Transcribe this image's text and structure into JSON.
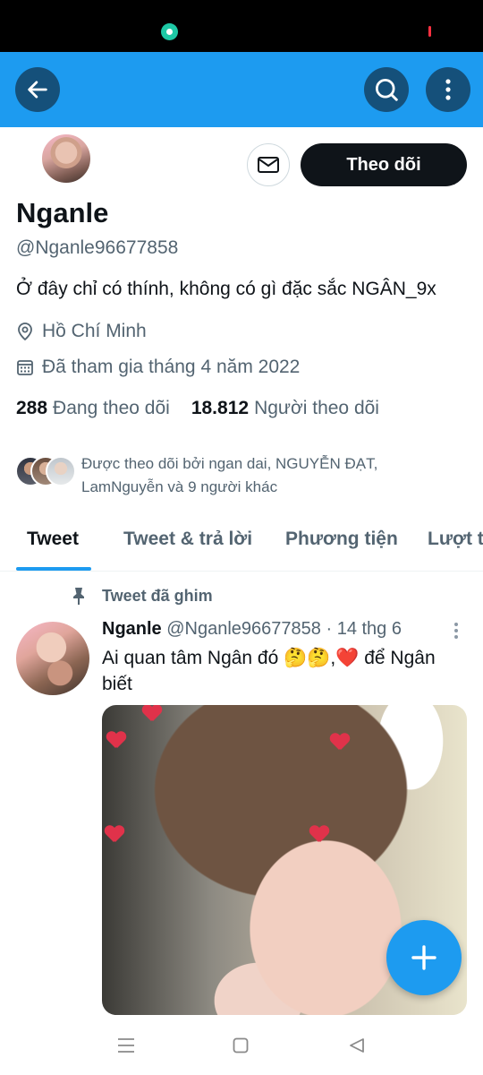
{
  "header": {
    "back_icon": "arrow-left-icon",
    "search_icon": "search-icon",
    "more_icon": "more-vertical-icon",
    "color": "#1d9bf0"
  },
  "profile": {
    "display_name": "Nganle",
    "handle": "@Nganle96677858",
    "bio": "Ở đây chỉ có thính, không có gì đặc sắc  NGÂN_9x",
    "location": "Hồ Chí Minh",
    "joined": "Đã tham gia tháng 4 năm 2022",
    "following_count": "288",
    "following_label": "Đang theo dõi",
    "followers_count": "18.812",
    "followers_label": "Người theo dõi",
    "follow_button": "Theo dõi",
    "followed_by_text": "Được theo dõi bởi ngan dai, NGUYỄN ĐẠT, LamNguyễn và 9 người khác"
  },
  "tabs": [
    {
      "label": "Tweet",
      "active": true
    },
    {
      "label": "Tweet & trả lời",
      "active": false
    },
    {
      "label": "Phương tiện",
      "active": false
    },
    {
      "label": "Lượt thích",
      "active": false
    }
  ],
  "pinned_tweet": {
    "pinned_label": "Tweet đã ghim",
    "author_name": "Nganle",
    "author_handle": "@Nganle96677858",
    "date": "· 14 thg 6",
    "text": "Ai quan tâm Ngân đó 🤔🤔,❤️ để Ngân biết"
  },
  "fab_icon": "plus-icon",
  "accent": "#1d9bf0"
}
